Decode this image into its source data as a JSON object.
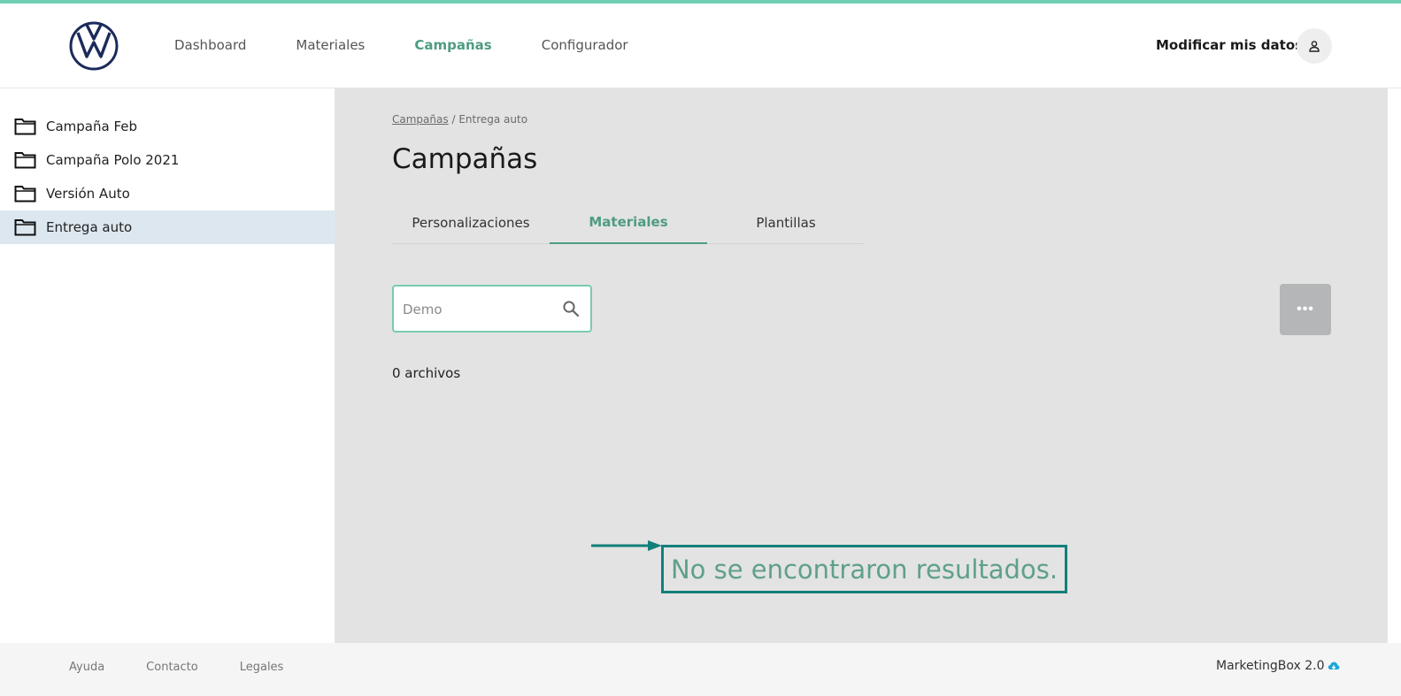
{
  "colors": {
    "accent": "#4f9c82",
    "top_strip": "#6fcfb3",
    "highlight_box": "#127f7a",
    "selected_row": "#dce7ef",
    "main_bg": "#e3e3e3",
    "logo": "#1b2b5a"
  },
  "header": {
    "logo_icon": "vw-logo-icon",
    "nav": [
      {
        "label": "Dashboard",
        "active": false
      },
      {
        "label": "Materiales",
        "active": false
      },
      {
        "label": "Campañas",
        "active": true
      },
      {
        "label": "Configurador",
        "active": false
      }
    ],
    "modify_label": "Modificar mis datos",
    "user_icon": "user-icon"
  },
  "sidebar": {
    "folder_icon": "folder-icon",
    "items": [
      {
        "label": "Campaña Feb",
        "selected": false
      },
      {
        "label": "Campaña Polo 2021",
        "selected": false
      },
      {
        "label": "Versión Auto",
        "selected": false
      },
      {
        "label": "Entrega auto",
        "selected": true
      }
    ]
  },
  "main": {
    "breadcrumb": {
      "link": "Campañas",
      "separator": "/",
      "current": "Entrega auto"
    },
    "title": "Campañas",
    "tabs": [
      {
        "label": "Personalizaciones",
        "active": false
      },
      {
        "label": "Materiales",
        "active": true
      },
      {
        "label": "Plantillas",
        "active": false
      }
    ],
    "search": {
      "placeholder": "Demo",
      "value": ""
    },
    "more_label": "•••",
    "file_count": "0 archivos",
    "empty_message": "No se encontraron resultados."
  },
  "footer": {
    "links": [
      "Ayuda",
      "Contacto",
      "Legales"
    ],
    "brand": "MarketingBox 2.0",
    "brand_icon": "cloud-icon"
  }
}
